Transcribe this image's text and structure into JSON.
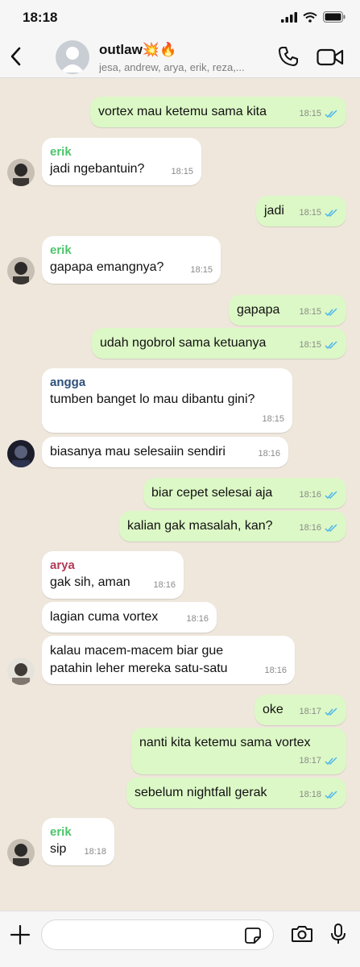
{
  "status_bar": {
    "time": "18:18"
  },
  "header": {
    "title": "outlaw💥🔥",
    "members": "jesa, andrew, arya, erik, reza,..."
  },
  "colors": {
    "outgoing_bubble": "#dcf8c6",
    "incoming_bubble": "#ffffff",
    "read_ticks": "#4fb6ec",
    "chat_background": "#efe7dc",
    "sender_erik": "#4cc46b",
    "sender_angga": "#2e4f7a",
    "sender_arya": "#b23a55"
  },
  "icons": {
    "back": "chevron-left-icon",
    "call": "phone-icon",
    "video": "video-camera-icon",
    "attach": "plus-icon",
    "sticker": "sticker-icon",
    "camera": "camera-icon",
    "mic": "microphone-icon",
    "read_receipt": "double-check-icon"
  },
  "messages": [
    {
      "dir": "out",
      "text": "vortex mau ketemu sama kita",
      "time": "18:15"
    },
    {
      "dir": "in",
      "sender": "erik",
      "text": "jadi ngebantuin?",
      "time": "18:15"
    },
    {
      "dir": "out",
      "text": "jadi",
      "time": "18:15"
    },
    {
      "dir": "in",
      "sender": "erik",
      "text": "gapapa emangnya?",
      "time": "18:15"
    },
    {
      "dir": "out",
      "text": "gapapa",
      "time": "18:15"
    },
    {
      "dir": "out",
      "text": "udah ngobrol sama ketuanya",
      "time": "18:15"
    },
    {
      "dir": "in",
      "sender": "angga",
      "text": "tumben banget lo mau dibantu gini?",
      "time": "18:15"
    },
    {
      "dir": "in",
      "text": "biasanya mau selesaiin sendiri",
      "time": "18:16"
    },
    {
      "dir": "out",
      "text": "biar cepet selesai aja",
      "time": "18:16"
    },
    {
      "dir": "out",
      "text": "kalian gak masalah, kan?",
      "time": "18:16"
    },
    {
      "dir": "in",
      "sender": "arya",
      "text": "gak sih, aman",
      "time": "18:16"
    },
    {
      "dir": "in",
      "text": "lagian cuma vortex",
      "time": "18:16"
    },
    {
      "dir": "in",
      "text_line1": "kalau macem-macem biar gue",
      "text_line2": "patahin leher mereka satu-satu",
      "time": "18:16"
    },
    {
      "dir": "out",
      "text": "oke",
      "time": "18:17"
    },
    {
      "dir": "out",
      "text": "nanti kita ketemu sama vortex",
      "time": "18:17"
    },
    {
      "dir": "out",
      "text": "sebelum nightfall gerak",
      "time": "18:18"
    },
    {
      "dir": "in",
      "sender": "erik",
      "text": "sip",
      "time": "18:18"
    }
  ],
  "composer": {
    "placeholder": ""
  }
}
